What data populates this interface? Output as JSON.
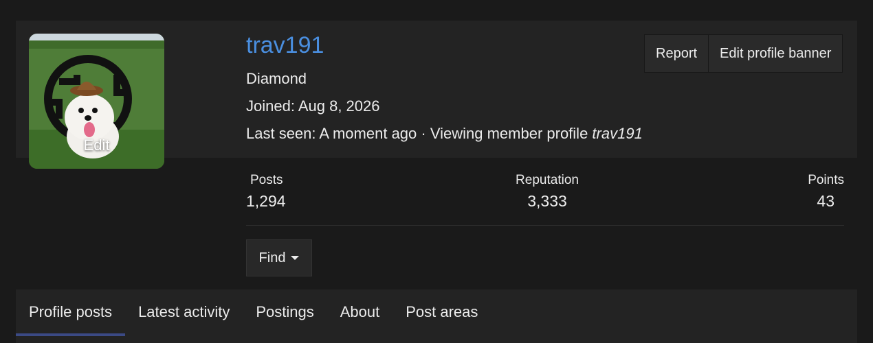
{
  "profile": {
    "username": "trav191",
    "rank": "Diamond",
    "joined": "Joined: Aug 8, 2026",
    "last_seen_prefix": "Last seen: A moment ago · Viewing member profile ",
    "last_seen_italic": "trav191",
    "avatar_edit_label": "Edit"
  },
  "actions": {
    "report_label": "Report",
    "edit_banner_label": "Edit profile banner",
    "find_label": "Find"
  },
  "stats": {
    "posts_label": "Posts",
    "posts_value": "1,294",
    "reputation_label": "Reputation",
    "reputation_value": "3,333",
    "points_label": "Points",
    "points_value": "43"
  },
  "tabs": [
    {
      "label": "Profile posts",
      "active": true
    },
    {
      "label": "Latest activity",
      "active": false
    },
    {
      "label": "Postings",
      "active": false
    },
    {
      "label": "About",
      "active": false
    },
    {
      "label": "Post areas",
      "active": false
    }
  ],
  "colors": {
    "username": "#4a8fe0",
    "active_tab_underline": "#3b4a85",
    "background": "#1a1a1a",
    "panel": "#232323"
  }
}
